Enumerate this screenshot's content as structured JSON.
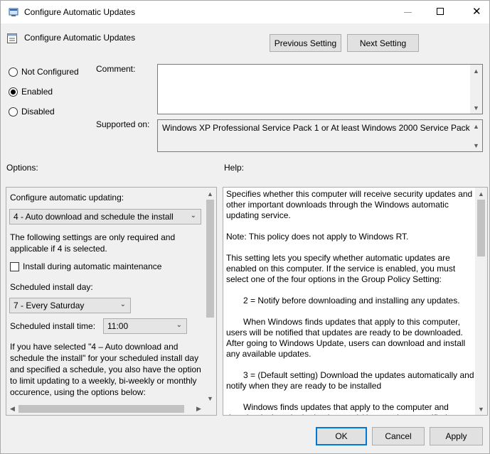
{
  "window": {
    "title": "Configure Automatic Updates",
    "close_glyph": "✕"
  },
  "header": {
    "policy_name": "Configure Automatic Updates",
    "prev_label": "Previous Setting",
    "next_label": "Next Setting"
  },
  "state": {
    "options": [
      "Not Configured",
      "Enabled",
      "Disabled"
    ],
    "selected": "Enabled"
  },
  "comment": {
    "label": "Comment:",
    "value": ""
  },
  "supported": {
    "label": "Supported on:",
    "value": "Windows XP Professional Service Pack 1 or At least Windows 2000 Service Pack 3"
  },
  "options_panel": {
    "label": "Options:",
    "configure_label": "Configure automatic updating:",
    "configure_value": "4 - Auto download and schedule the install",
    "note_line1": "The following settings are only required and",
    "note_line2": "applicable if 4 is selected.",
    "install_maint_label": "Install during automatic maintenance",
    "day_label": "Scheduled install day:",
    "day_value": "7 - Every Saturday",
    "time_label": "Scheduled install time:",
    "time_value": "11:00",
    "desc_lines": [
      "If you have selected \"4 – Auto download and",
      "schedule the install\" for your scheduled install day",
      "and specified a schedule, you also have the option",
      "to limit updating to a weekly, bi-weekly or monthly",
      "occurence, using the options below:"
    ]
  },
  "help_panel": {
    "label": "Help:",
    "paragraphs": [
      "Specifies whether this computer will receive security updates and other important downloads through the Windows automatic updating service.",
      "Note: This policy does not apply to Windows RT.",
      "This setting lets you specify whether automatic updates are enabled on this computer. If the service is enabled, you must select one of the four options in the Group Policy Setting:",
      "2 = Notify before downloading and installing any updates.",
      "When Windows finds updates that apply to this computer, users will be notified that updates are ready to be downloaded. After going to Windows Update, users can download and install any available updates.",
      "3 = (Default setting) Download the updates automatically and notify when they are ready to be installed",
      "Windows finds updates that apply to the computer and downloads them in the background (the user is not notified"
    ]
  },
  "footer": {
    "ok_label": "OK",
    "cancel_label": "Cancel",
    "apply_label": "Apply"
  },
  "colors": {
    "accent": "#0078d7",
    "window_bg": "#f0f0f0"
  }
}
